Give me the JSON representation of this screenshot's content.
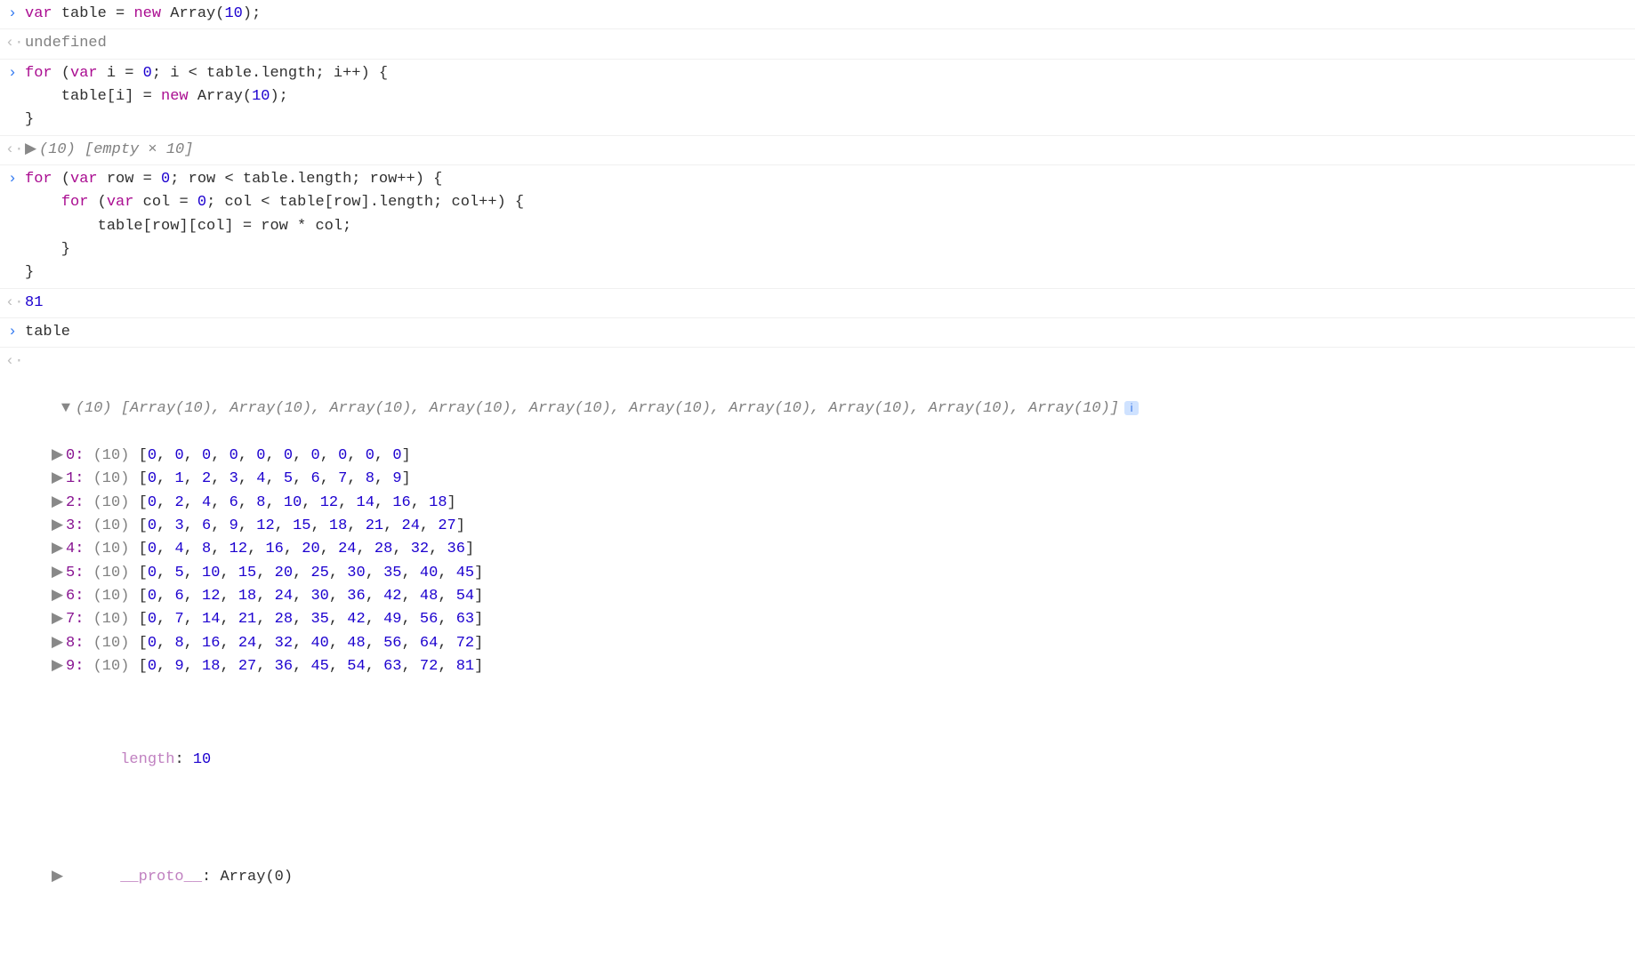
{
  "entries": [
    {
      "kind": "input",
      "tokens": [
        {
          "t": "var ",
          "c": "kw"
        },
        {
          "t": "table = ",
          "c": "op"
        },
        {
          "t": "new ",
          "c": "kw"
        },
        {
          "t": "Array(",
          "c": "op"
        },
        {
          "t": "10",
          "c": "num"
        },
        {
          "t": ");",
          "c": "op"
        }
      ]
    },
    {
      "kind": "output",
      "tokens": [
        {
          "t": "undefined",
          "c": "grey"
        }
      ]
    },
    {
      "kind": "input",
      "lines": [
        [
          {
            "t": "for ",
            "c": "kw"
          },
          {
            "t": "(",
            "c": "op"
          },
          {
            "t": "var ",
            "c": "kw"
          },
          {
            "t": "i = ",
            "c": "op"
          },
          {
            "t": "0",
            "c": "num"
          },
          {
            "t": "; i < table.length; i++) {",
            "c": "op"
          }
        ],
        [
          {
            "t": "    table[i] = ",
            "c": "op"
          },
          {
            "t": "new ",
            "c": "kw"
          },
          {
            "t": "Array(",
            "c": "op"
          },
          {
            "t": "10",
            "c": "num"
          },
          {
            "t": ");",
            "c": "op"
          }
        ],
        [
          {
            "t": "}",
            "c": "op"
          }
        ]
      ]
    },
    {
      "kind": "output",
      "disclose": "right",
      "tokens": [
        {
          "t": "(10) ",
          "c": "grey italic"
        },
        {
          "t": "[empty × 10]",
          "c": "grey italic"
        }
      ]
    },
    {
      "kind": "input",
      "lines": [
        [
          {
            "t": "for ",
            "c": "kw"
          },
          {
            "t": "(",
            "c": "op"
          },
          {
            "t": "var ",
            "c": "kw"
          },
          {
            "t": "row = ",
            "c": "op"
          },
          {
            "t": "0",
            "c": "num"
          },
          {
            "t": "; row < table.length; row++) {",
            "c": "op"
          }
        ],
        [
          {
            "t": "    ",
            "c": "op"
          },
          {
            "t": "for ",
            "c": "kw"
          },
          {
            "t": "(",
            "c": "op"
          },
          {
            "t": "var ",
            "c": "kw"
          },
          {
            "t": "col = ",
            "c": "op"
          },
          {
            "t": "0",
            "c": "num"
          },
          {
            "t": "; col < table[row].length; col++) {",
            "c": "op"
          }
        ],
        [
          {
            "t": "        table[row][col] = row * col;",
            "c": "op"
          }
        ],
        [
          {
            "t": "    }",
            "c": "op"
          }
        ],
        [
          {
            "t": "}",
            "c": "op"
          }
        ]
      ]
    },
    {
      "kind": "output",
      "tokens": [
        {
          "t": "81",
          "c": "num"
        }
      ]
    },
    {
      "kind": "input",
      "tokens": [
        {
          "t": "table",
          "c": "op"
        }
      ]
    }
  ],
  "tableHeader": {
    "count": "(10) ",
    "body": "[Array(10), Array(10), Array(10), Array(10), Array(10), Array(10), Array(10), Array(10), Array(10), Array(10)]"
  },
  "tableRows": [
    {
      "idx": "0",
      "count": "(10)",
      "vals": [
        0,
        0,
        0,
        0,
        0,
        0,
        0,
        0,
        0,
        0
      ]
    },
    {
      "idx": "1",
      "count": "(10)",
      "vals": [
        0,
        1,
        2,
        3,
        4,
        5,
        6,
        7,
        8,
        9
      ]
    },
    {
      "idx": "2",
      "count": "(10)",
      "vals": [
        0,
        2,
        4,
        6,
        8,
        10,
        12,
        14,
        16,
        18
      ]
    },
    {
      "idx": "3",
      "count": "(10)",
      "vals": [
        0,
        3,
        6,
        9,
        12,
        15,
        18,
        21,
        24,
        27
      ]
    },
    {
      "idx": "4",
      "count": "(10)",
      "vals": [
        0,
        4,
        8,
        12,
        16,
        20,
        24,
        28,
        32,
        36
      ]
    },
    {
      "idx": "5",
      "count": "(10)",
      "vals": [
        0,
        5,
        10,
        15,
        20,
        25,
        30,
        35,
        40,
        45
      ]
    },
    {
      "idx": "6",
      "count": "(10)",
      "vals": [
        0,
        6,
        12,
        18,
        24,
        30,
        36,
        42,
        48,
        54
      ]
    },
    {
      "idx": "7",
      "count": "(10)",
      "vals": [
        0,
        7,
        14,
        21,
        28,
        35,
        42,
        49,
        56,
        63
      ]
    },
    {
      "idx": "8",
      "count": "(10)",
      "vals": [
        0,
        8,
        16,
        24,
        32,
        40,
        48,
        56,
        64,
        72
      ]
    },
    {
      "idx": "9",
      "count": "(10)",
      "vals": [
        0,
        9,
        18,
        27,
        36,
        45,
        54,
        63,
        72,
        81
      ]
    }
  ],
  "lengthLabel": "length",
  "lengthValue": "10",
  "protoLabel": "__proto__",
  "protoValue": "Array(0)",
  "glyphs": {
    "inputPrompt": "›",
    "outputPrompt": "‹·",
    "triRight": "▶",
    "triDown": "▼",
    "info": "i"
  }
}
